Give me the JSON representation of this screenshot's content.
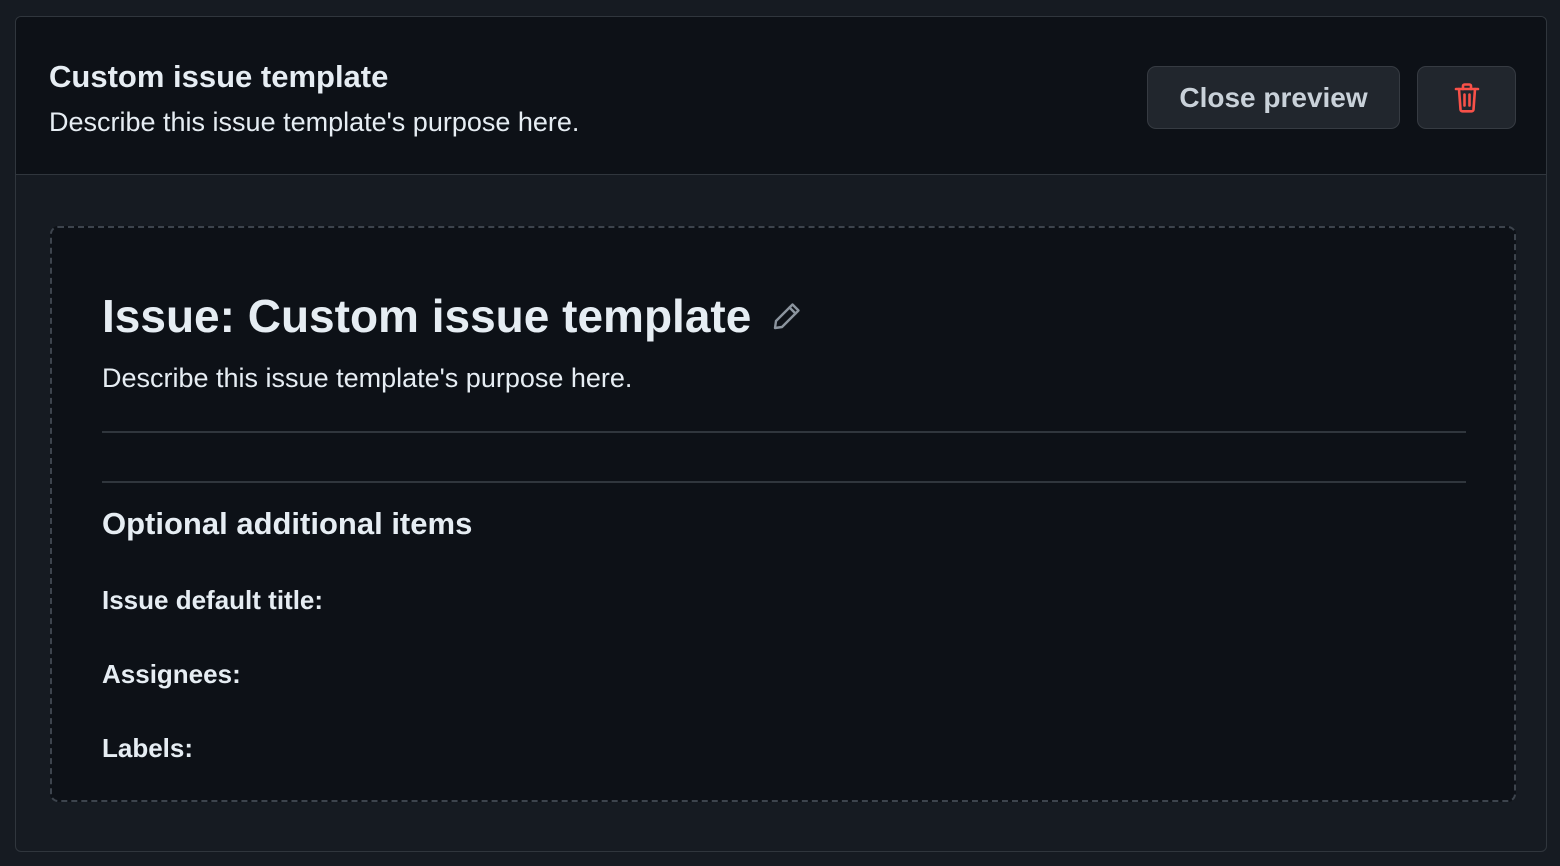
{
  "header": {
    "title": "Custom issue template",
    "description": "Describe this issue template's purpose here.",
    "close_preview_label": "Close preview",
    "delete_icon": "trash-icon"
  },
  "preview": {
    "title": "Issue: Custom issue template",
    "edit_icon": "pencil-icon",
    "description": "Describe this issue template's purpose here.",
    "optional_heading": "Optional additional items",
    "fields": [
      {
        "label": "Issue default title:"
      },
      {
        "label": "Assignees:"
      },
      {
        "label": "Labels:"
      }
    ]
  },
  "colors": {
    "background": "#161b22",
    "surface": "#0d1117",
    "border": "#30363d",
    "text": "#e6edf3",
    "danger": "#f85149"
  }
}
